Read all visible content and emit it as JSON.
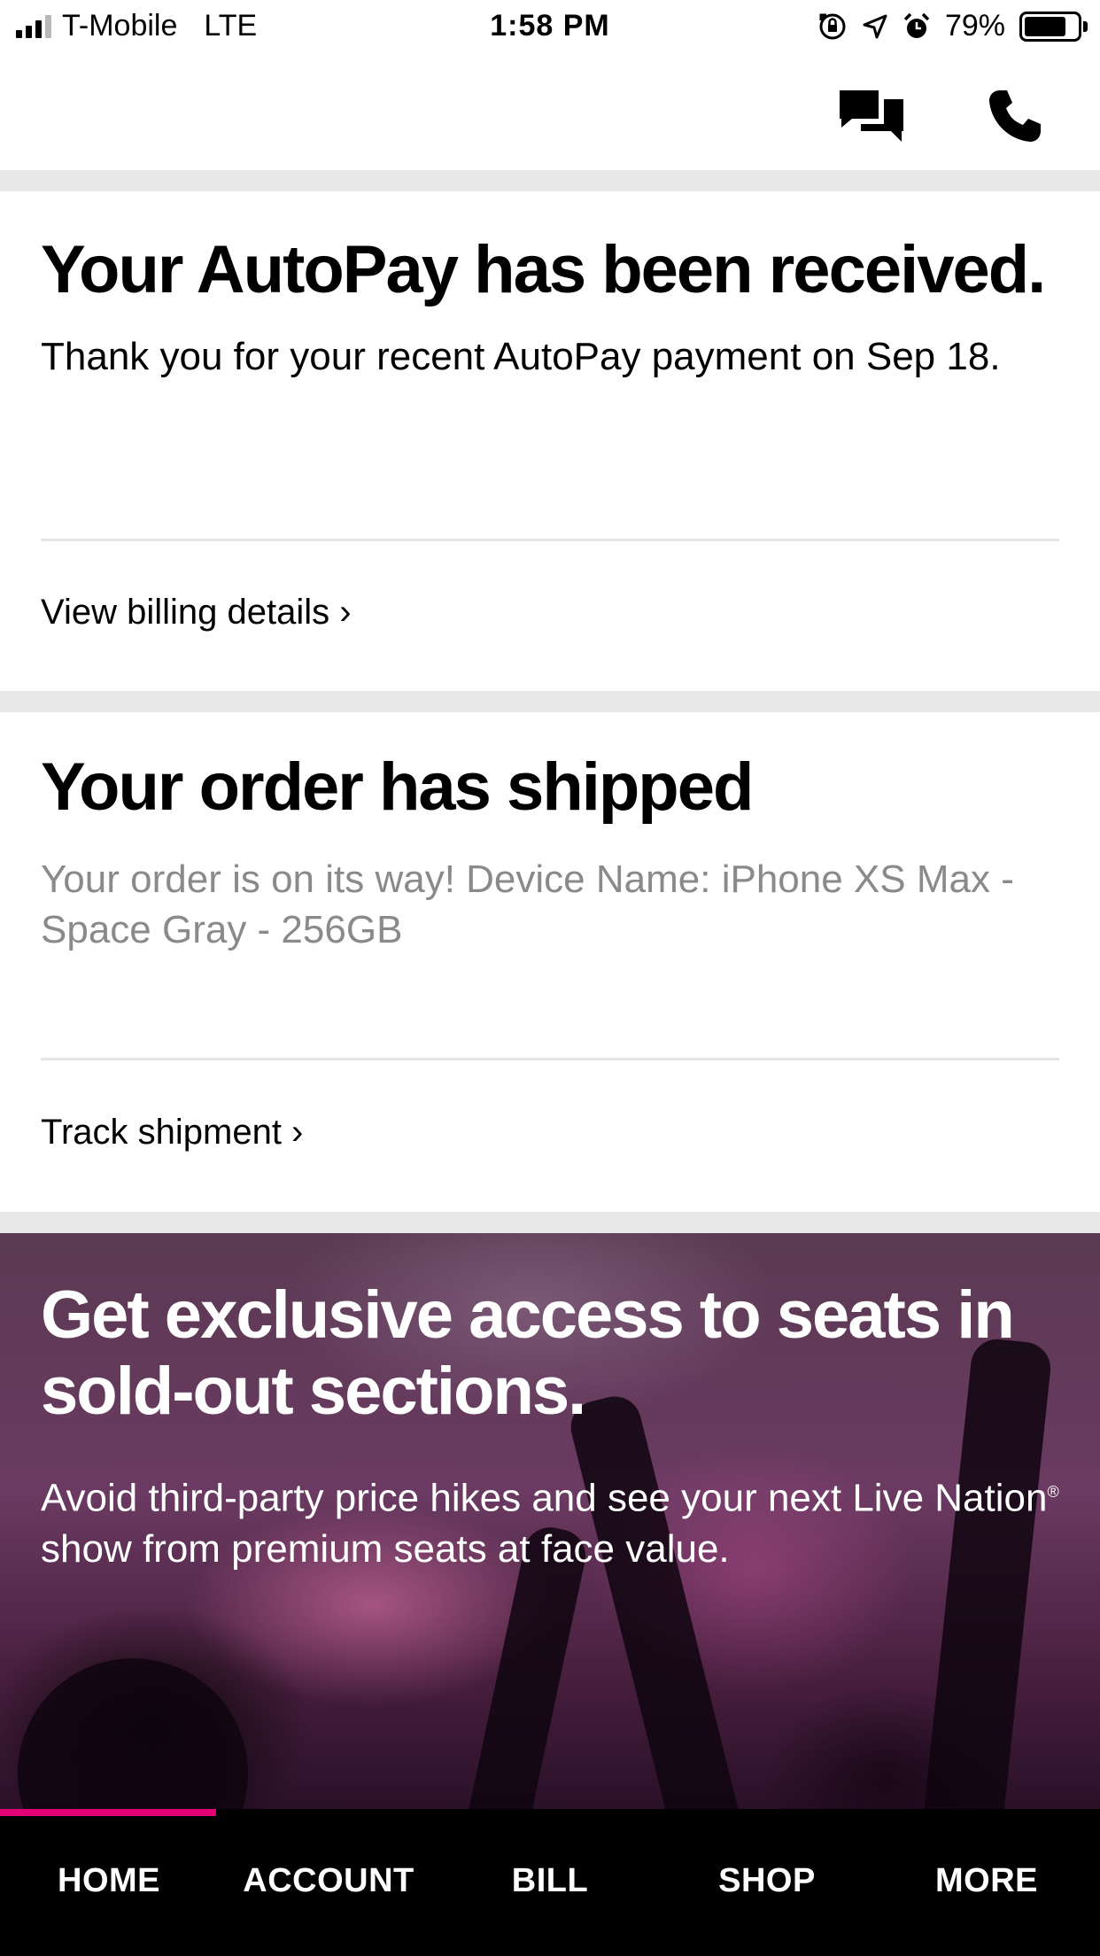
{
  "status_bar": {
    "carrier": "T-Mobile",
    "network": "LTE",
    "time": "1:58 PM",
    "battery_percent": "79%",
    "battery_level": 0.79,
    "icons": [
      "signal-icon",
      "orientation-lock-icon",
      "location-icon",
      "alarm-icon",
      "battery-icon"
    ]
  },
  "top_actions": {
    "icons": [
      "chat-icon",
      "phone-icon"
    ]
  },
  "autopay_card": {
    "title": "Your AutoPay has been received.",
    "body": "Thank you for your recent AutoPay payment on Sep 18.",
    "link": "View billing details ›"
  },
  "shipping_card": {
    "title": "Your order has shipped",
    "body": "Your order is on its way! Device Name: iPhone XS Max - Space Gray - 256GB",
    "link": "Track shipment ›"
  },
  "promo": {
    "title": "Get exclusive access to seats in sold-out sections.",
    "body_part1": "Avoid third-party price hikes and see your next Live Nation",
    "registered_mark": "®",
    "body_part2": " show from premium seats at face value."
  },
  "tabbar": {
    "active_color": "#e20074",
    "tabs": [
      {
        "label": "HOME",
        "active": true
      },
      {
        "label": "ACCOUNT",
        "active": false
      },
      {
        "label": "BILL",
        "active": false
      },
      {
        "label": "SHOP",
        "active": false
      },
      {
        "label": "MORE",
        "active": false
      }
    ]
  }
}
